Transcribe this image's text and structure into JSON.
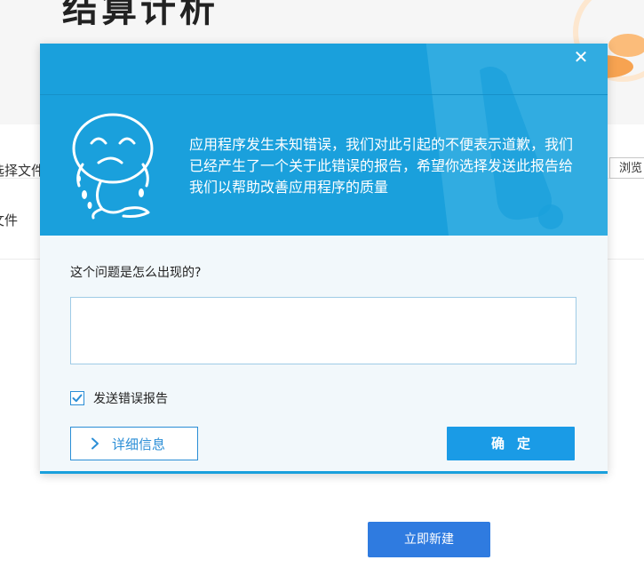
{
  "background": {
    "page_title": "结算计析",
    "row1_label": "选择文件",
    "row2_label": "文件",
    "browse_button": "浏览",
    "new_button": "立即新建"
  },
  "dialog": {
    "close_icon": "close-icon",
    "message": "应用程序发生未知错误，我们对此引起的不便表示道歉，我们已经产生了一个关于此错误的报告，希望你选择发送此报告给我们以帮助改善应用程序的质量",
    "question": "这个问题是怎么出现的?",
    "description_value": "",
    "send_report": {
      "label": "发送错误报告",
      "checked": true
    },
    "details_button": "详细信息",
    "ok_button": "确定"
  },
  "colors": {
    "dialog_header": "#1aa0dc",
    "dialog_body": "#f2f8fb",
    "primary_button": "#1a9be6",
    "new_button": "#2f7be0"
  }
}
